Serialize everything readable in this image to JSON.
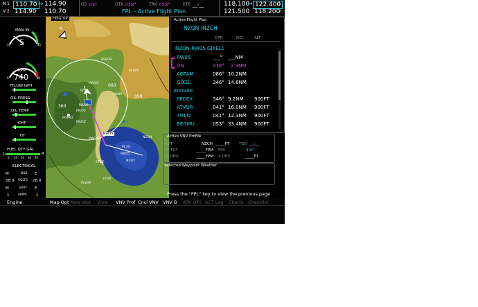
{
  "topbar": {
    "nav_label": "N",
    "com_label": "C",
    "nav_num": "1",
    "vor_label": "V",
    "vor_num": "2",
    "nav1_active": "110.70",
    "nav1_standby": "114.90",
    "nav2_active": "114.90",
    "nav2_standby": "110.70",
    "swap_arrow": "↔",
    "gs_label": "GS",
    "gs_value": "0",
    "gs_unit": "KT",
    "dtk_label": "DTK",
    "dtk_value": "018°",
    "trk_label": "TRK",
    "trk_value": "053°",
    "ete_label": "ETE",
    "ete_value": "__:__",
    "page_title": "FPL – Active Flight Plan",
    "com1_active": "118.100",
    "com1_standby": "122.400",
    "com2_active": "121.500",
    "com2_standby": "118.200",
    "com_num1": "1",
    "com_num2": "2"
  },
  "engine": {
    "manin_label": "MAN IN",
    "manin_value": "5",
    "manin_min": "10",
    "manin_max": "35",
    "rpm_label": "RPM",
    "rpm_value": "740",
    "rpm_min": "0",
    "rpm_max": "30",
    "fflow_label": "FFLOW GPH",
    "oilp_label": "OIL PRESS",
    "oilt_label": "OIL TEMP",
    "cht_label": "CHT",
    "tit_label": "TIT",
    "fuel_label": "FUEL QTY GAL",
    "fuel_l": "L",
    "fuel_r": "R",
    "fuel_ticks": [
      "0",
      "10",
      "20",
      "30",
      "40"
    ],
    "elec_label": "ELECTRICAL",
    "m_label": "M",
    "e_label": "E",
    "bus_label": "BUS",
    "volts_label": "VOLTS",
    "batt_label": "BATT",
    "amps_label": "AMPS",
    "bus_m": "28.0",
    "bus_e": "28.0",
    "batt_m": "1",
    "batt_e": "1"
  },
  "map": {
    "hdg_up": "HDG UP",
    "north": "N",
    "labels": [
      "360",
      "060",
      "090",
      "0/30",
      "RW05",
      "MAGIC",
      "IGARI",
      "RGN42",
      "6SVOR",
      "KLSAS",
      "NZQN",
      "RN/05",
      "RN/35",
      "RN/4Z",
      "PC3S",
      "MACHE",
      "RW05",
      "NZQT",
      "YVOR",
      "2TSIE",
      "7SVOR"
    ]
  },
  "fpl": {
    "header": "Active Flight Plan",
    "route": "NZQN /NZCH",
    "col_dtk": "DTK",
    "col_dis": "DIS",
    "col_alt": "ALT",
    "procedure": "NZQN-RW05.GIXEL1",
    "rows": [
      {
        "wpt": "RW05",
        "dtk": "___°",
        "dis": "___NM",
        "alt": ""
      },
      {
        "wpt": "QN",
        "dtk": "018°",
        "dis": "2.9NM",
        "alt": ""
      },
      {
        "wpt": "AGTAM",
        "dtk": "086°",
        "dis": "10.2NM",
        "alt": ""
      },
      {
        "wpt": "GIXEL",
        "dtk": "346°",
        "dis": "14.6NM",
        "alt": ""
      },
      {
        "wpt": "Enroute",
        "dtk": "",
        "dis": "",
        "alt": ""
      },
      {
        "wpt": "EPDEX",
        "dtk": "346°",
        "dis": "9.2NM",
        "alt": "900FT"
      },
      {
        "wpt": "ATVOR",
        "dtk": "041°",
        "dis": "16.0NM",
        "alt": "900FT"
      },
      {
        "wpt": "TIMJO",
        "dtk": "041°",
        "dis": "12.3NM",
        "alt": "900FT"
      },
      {
        "wpt": "BEGMU",
        "dtk": "053°",
        "dis": "33.4NM",
        "alt": "900FT"
      }
    ],
    "vnv_header": "Active VNV Profile",
    "vnv_wpt_label": "WPT",
    "vnv_wpt": "NZCH",
    "vnv_wpt_alt": "_____FT",
    "vnv_tod_label": "TOD",
    "vnv_tod": "__:__",
    "vnv_vstgt_label": "VS TGT",
    "vnv_vstgt": "_____FPM",
    "vnv_fpa_label": "FPA",
    "vnv_fpa": "-3.0°",
    "vnv_vsreq_label": "VS REQ",
    "vnv_vsreq": "_____FPM",
    "vnv_vdev_label": "V DEV",
    "vnv_vdev": "_____FT",
    "wx_header": "Selected Waypoint Weather",
    "footer": "Press the \"FPL\" key to view the previous page"
  },
  "softkeys": [
    {
      "label": "Engine",
      "active": true
    },
    {
      "label": "",
      "active": false
    },
    {
      "label": "Map Opt",
      "active": true
    },
    {
      "label": "New Wpt",
      "active": false
    },
    {
      "label": "View",
      "active": false
    },
    {
      "label": "VNV Prof",
      "active": true
    },
    {
      "label": "Cncl VNV",
      "active": true
    },
    {
      "label": "VNV Ð",
      "active": true
    },
    {
      "label": "ATK OFS",
      "active": false
    },
    {
      "label": "ACT Leg",
      "active": false
    },
    {
      "label": "Charts",
      "active": false
    },
    {
      "label": "Checklist",
      "active": false
    }
  ],
  "colors": {
    "cyan": "#23d3e8",
    "magenta": "#e040e0",
    "green": "#3ad33a",
    "bg": "#000000"
  }
}
